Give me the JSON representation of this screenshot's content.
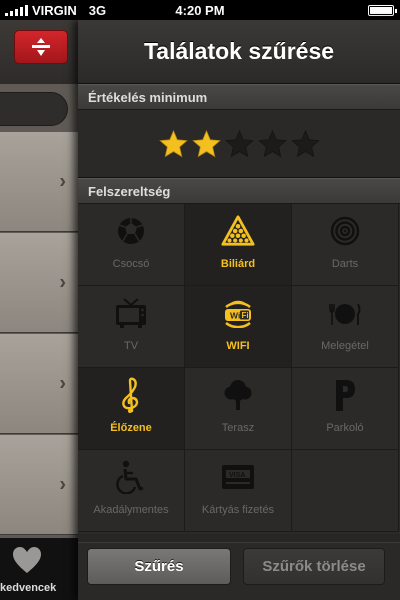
{
  "status_bar": {
    "carrier": "VIRGIN",
    "network": "3G",
    "time": "4:20 PM",
    "battery_level": 1.0
  },
  "background": {
    "favorites_label": "kedvencek",
    "accent_color": "#c81e24"
  },
  "panel": {
    "title": "Találatok szűrése",
    "rating_section": {
      "label": "Értékelés minimum",
      "value": 2,
      "max": 5,
      "star_active_color": "#f4c020",
      "star_inactive_color": "#1c1b1a"
    },
    "amenities_section": {
      "label": "Felszereltség",
      "items": [
        {
          "label": "Csocsó",
          "icon": "table-football-icon",
          "active": false
        },
        {
          "label": "Biliárd",
          "icon": "billiard-icon",
          "active": true
        },
        {
          "label": "Darts",
          "icon": "darts-icon",
          "active": false
        },
        {
          "label": "TV",
          "icon": "tv-icon",
          "active": false
        },
        {
          "label": "WIFI",
          "icon": "wifi-icon",
          "active": true
        },
        {
          "label": "Melegétel",
          "icon": "hot-food-icon",
          "active": false
        },
        {
          "label": "Élőzene",
          "icon": "live-music-icon",
          "active": true
        },
        {
          "label": "Terasz",
          "icon": "terrace-tree-icon",
          "active": false
        },
        {
          "label": "Parkoló",
          "icon": "parking-icon",
          "active": false
        },
        {
          "label": "Akadálymentes",
          "icon": "wheelchair-icon",
          "active": false
        },
        {
          "label": "Kártyás fizetés",
          "icon": "credit-card-icon",
          "active": false
        }
      ]
    },
    "buttons": {
      "filter_label": "Szűrés",
      "clear_label": "Szűrők törlése"
    }
  }
}
